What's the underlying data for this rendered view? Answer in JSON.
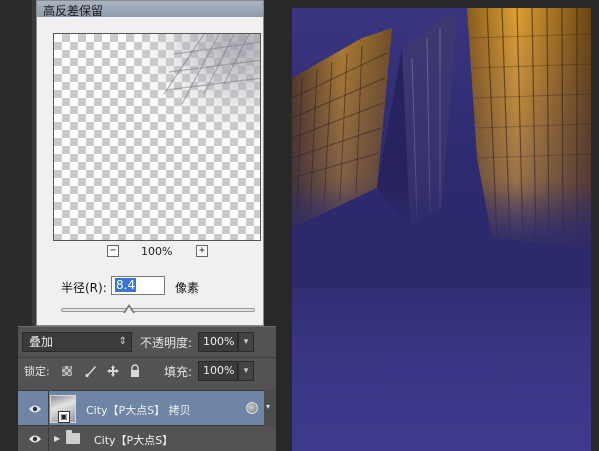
{
  "dialog": {
    "title": "高反差保留",
    "zoom": {
      "minus": "−",
      "value": "100%",
      "plus": "+"
    },
    "radius": {
      "label": "半径(R):",
      "value": "8.4",
      "unit": "像素"
    }
  },
  "layers_panel": {
    "blend_mode": "叠加",
    "blend_arrow": "⇕",
    "opacity_label": "不透明度:",
    "opacity_value": "100%",
    "lock_label": "锁定:",
    "fill_label": "填充:",
    "fill_value": "100%",
    "dropdown_arrow": "▾",
    "layers": [
      {
        "name": "City【P大点S】 拷贝",
        "active": true,
        "type": "smart-object"
      },
      {
        "name": "City【P大点S】",
        "active": false,
        "type": "group"
      }
    ]
  },
  "colors": {
    "canvas_purple": "#2c2a6a",
    "building_gold": "#b07a1c",
    "active_layer": "#6e85a5",
    "selection_blue": "#3875d7"
  }
}
